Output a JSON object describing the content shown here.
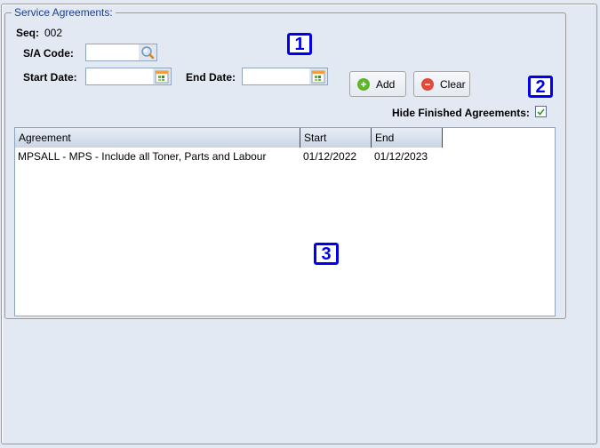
{
  "panel": {
    "legend": "Service Agreements:"
  },
  "seq": {
    "label": "Seq:",
    "value": "002"
  },
  "sa_code": {
    "label": "S/A Code:",
    "value": "",
    "icon": "magnifier-icon"
  },
  "start_date": {
    "label": "Start Date:",
    "value": "",
    "icon": "calendar-icon"
  },
  "end_date": {
    "label": "End Date:",
    "value": "",
    "icon": "calendar-icon"
  },
  "buttons": {
    "add": "Add",
    "clear": "Clear"
  },
  "hide_finished": {
    "label": "Hide Finished Agreements:",
    "checked": true
  },
  "annotations": [
    "1",
    "2",
    "3"
  ],
  "table": {
    "columns": [
      "Agreement",
      "Start",
      "End"
    ],
    "rows": [
      [
        "MPSALL - MPS - Include all Toner, Parts and Labour",
        "01/12/2022",
        "01/12/2023"
      ]
    ]
  },
  "colors": {
    "legend": "#1a3d8f",
    "annotation": "#0000ee",
    "add": "#5fb52a",
    "clear": "#e04a3a"
  }
}
